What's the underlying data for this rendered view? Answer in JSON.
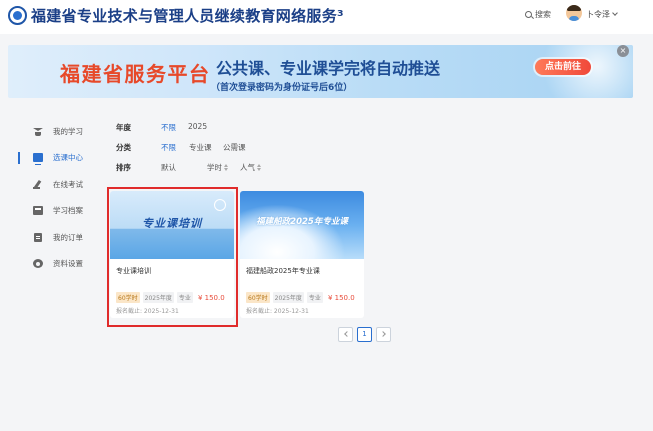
{
  "header": {
    "site_title": "福建省专业技术与管理人员继续教育网络服务³",
    "search_label": "搜索",
    "user_name": "卜令泽"
  },
  "banner": {
    "platform": "福建省服务平台",
    "headline": "公共课、专业课学完将自动推送",
    "subline": "（首次登录密码为身份证号后6位）",
    "cta": "点击前往",
    "close_glyph": "×"
  },
  "sidebar": {
    "items": [
      {
        "label": "我的学习",
        "icon": "graduation-cap-icon",
        "active": false
      },
      {
        "label": "选课中心",
        "icon": "monitor-icon",
        "active": true
      },
      {
        "label": "在线考试",
        "icon": "pen-icon",
        "active": false
      },
      {
        "label": "学习档案",
        "icon": "folder-icon",
        "active": false
      },
      {
        "label": "我的订单",
        "icon": "order-icon",
        "active": false
      },
      {
        "label": "资料设置",
        "icon": "gear-icon",
        "active": false
      }
    ]
  },
  "filters": {
    "year": {
      "label": "年度",
      "options": [
        "不限",
        "2025"
      ]
    },
    "category": {
      "label": "分类",
      "options": [
        "不限",
        "专业课",
        "公需课"
      ]
    },
    "sort": {
      "label": "排序",
      "options": [
        "默认",
        "学时",
        "人气"
      ]
    }
  },
  "courses": [
    {
      "thumb_text": "专业课培训",
      "title": "专业课培训",
      "hours": "60学时",
      "year": "2025年度",
      "type": "专业",
      "price": "¥ 150.0",
      "deadline": "报名截止: 2025-12-31"
    },
    {
      "thumb_text": "福建船政2025年专业课",
      "title": "福建船政2025年专业课",
      "hours": "60学时",
      "year": "2025年度",
      "type": "专业",
      "price": "¥ 150.0",
      "deadline": "报名截止: 2025-12-31"
    }
  ],
  "pagination": {
    "current": "1"
  },
  "colors": {
    "accent": "#2a6fcf",
    "title_blue": "#1b3f87",
    "price_red": "#e84d3c",
    "highlight_red": "#e02b2b"
  }
}
